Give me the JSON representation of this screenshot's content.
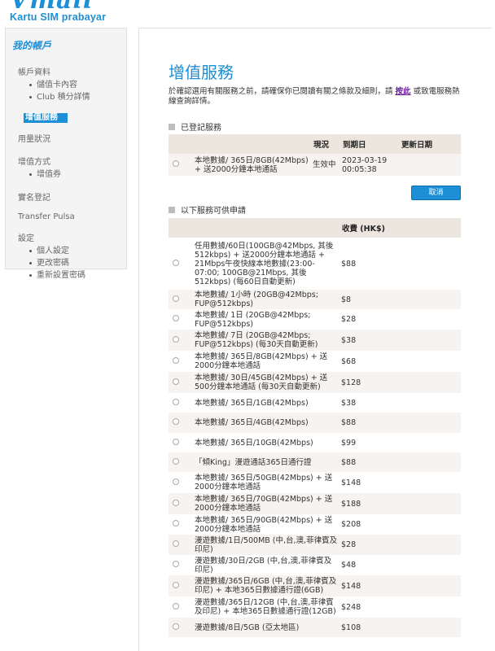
{
  "brand": {
    "logo_script": "Vmail",
    "logo_sub": "Kartu SIM prabayar",
    "accent": "#1d8fd6"
  },
  "sidebar": {
    "title": "我的帳戶",
    "account_info": "帳戶資料",
    "account_sub": [
      "儲值卡內容",
      "Club 積分詳情"
    ],
    "active": "增值服務",
    "usage": "用量狀況",
    "topup_method": "增值方式",
    "topup_sub": [
      "增值券"
    ],
    "realname": "實名登記",
    "transfer": "Transfer Pulsa",
    "settings": "設定",
    "settings_sub": [
      "個人設定",
      "更改密碼",
      "重新設置密碼"
    ]
  },
  "main": {
    "title": "增值服務",
    "intro_before": "於確認選用有關服務之前，請確保你已閱讀有關之條款及細則，請",
    "intro_link": "按此",
    "intro_after": "或致電服務熱線查詢詳情。",
    "registered_heading": "已登記服務",
    "registered_headers": {
      "status": "現況",
      "expiry": "到期日",
      "renew": "更新日期"
    },
    "registered": [
      {
        "name": "本地數據/ 365日/8GB(42Mbps) + 送2000分鐘本地通話",
        "status": "生效中",
        "expiry": "2023-03-19 00:05:38",
        "renew": ""
      }
    ],
    "cancel_label": "取消",
    "available_heading": "以下服務可供申請",
    "available_headers": {
      "fee": "收費 (HK$)"
    },
    "available": [
      {
        "name": "任用數據/60日(100GB@42Mbps, 其後512kbps) + 送2000分鐘本地通話 + 21Mbps午夜快線本地數據(23:00-07:00; 100GB@21Mbps, 其後512kbps) (每60日自動更新)",
        "fee": "$88"
      },
      {
        "name": "本地數據/ 1小時 (20GB@42Mbps; FUP@512kbps)",
        "fee": "$8"
      },
      {
        "name": "本地數據/ 1日 (20GB@42Mbps; FUP@512kbps)",
        "fee": "$28"
      },
      {
        "name": "本地數據/ 7日 (20GB@42Mbps; FUP@512kbps) (每30天自動更新)",
        "fee": "$38"
      },
      {
        "name": "本地數據/ 365日/8GB(42Mbps) + 送2000分鐘本地通話",
        "fee": "$68"
      },
      {
        "name": "本地數據/ 30日/45GB(42Mbps) + 送500分鐘本地通話 (每30天自動更新)",
        "fee": "$128"
      },
      {
        "name": "本地數據/ 365日/1GB(42Mbps)",
        "fee": "$38"
      },
      {
        "name": "本地數據/ 365日/4GB(42Mbps)",
        "fee": "$88"
      },
      {
        "name": "本地數據/ 365日/10GB(42Mbps)",
        "fee": "$99"
      },
      {
        "name": "「傾King」漫遊通話365日通行證",
        "fee": "$88"
      },
      {
        "name": "本地數據/ 365日/50GB(42Mbps) + 送2000分鐘本地通話",
        "fee": "$148"
      },
      {
        "name": "本地數據/ 365日/70GB(42Mbps) + 送2000分鐘本地通話",
        "fee": "$188"
      },
      {
        "name": "本地數據/ 365日/90GB(42Mbps) + 送2000分鐘本地通話",
        "fee": "$208"
      },
      {
        "name": "漫遊數據/1日/500MB (中,台,澳,菲律賓及印尼)",
        "fee": "$28"
      },
      {
        "name": "漫遊數據/30日/2GB (中,台,澳,菲律賓及印尼)",
        "fee": "$48"
      },
      {
        "name": "漫遊數據/365日/6GB (中,台,澳,菲律賓及印尼) + 本地365日數據通行證(6GB)",
        "fee": "$148"
      },
      {
        "name": "漫遊數據/365日/12GB (中,台,澳,菲律賓及印尼) + 本地365日數據通行證(12GB)",
        "fee": "$248"
      },
      {
        "name": "漫遊數據/8日/5GB (亞太地區)",
        "fee": "$108"
      }
    ]
  }
}
